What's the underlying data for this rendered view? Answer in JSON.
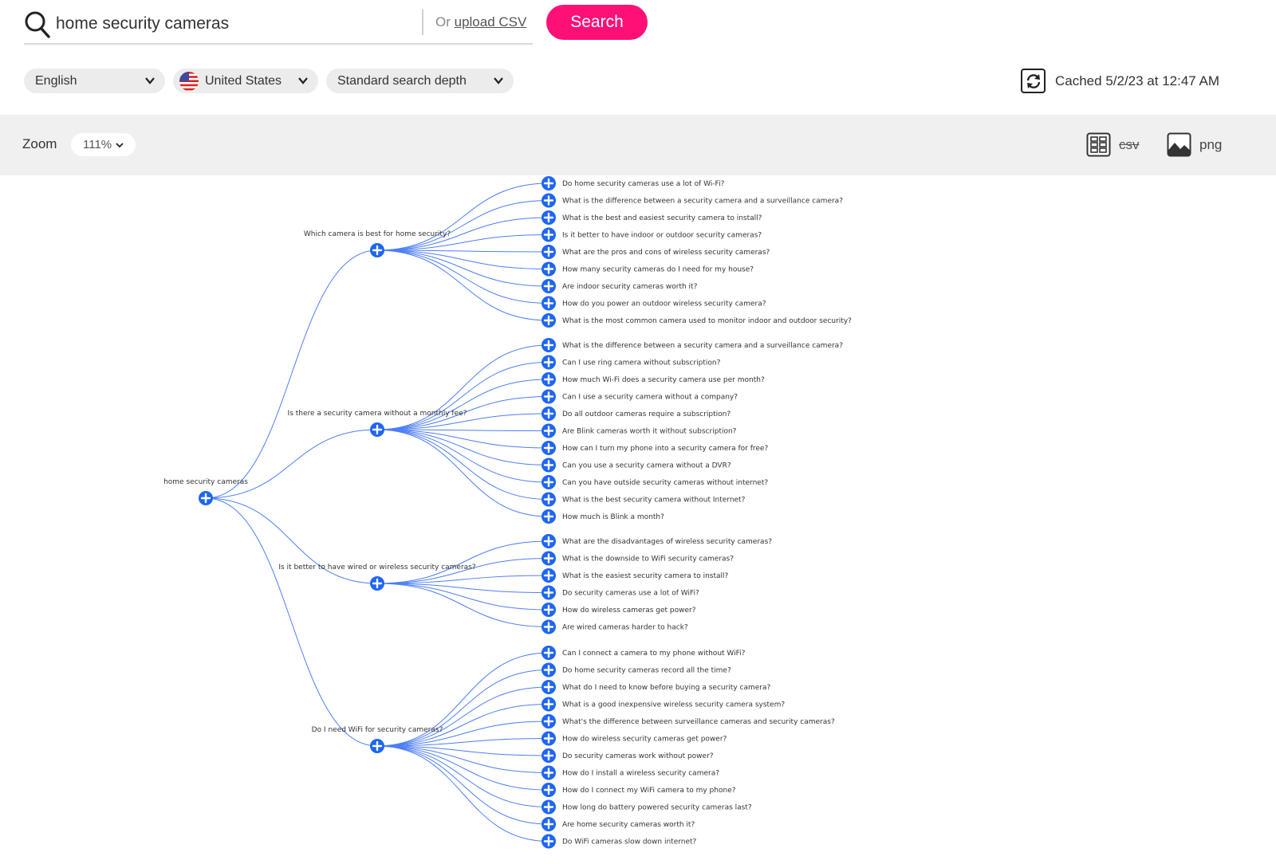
{
  "search": {
    "query": "home security cameras",
    "upload_prefix": "Or",
    "upload_link": "upload CSV",
    "button_label": "Search",
    "button_color": "#ff1077"
  },
  "filters": {
    "language": "English",
    "country": "United States",
    "depth": "Standard search depth"
  },
  "cached": {
    "text": "Cached 5/2/23 at 12:47 AM",
    "icon": "refresh-icon"
  },
  "toolbar": {
    "zoom_label": "Zoom",
    "zoom_value": "111%",
    "csv_label": "csv",
    "png_label": "png"
  },
  "colors": {
    "node": "#1f66f2",
    "link": "#4d7ef7",
    "toolbar_bg": "#f0f0f0"
  },
  "tree": {
    "root": "home security cameras",
    "branches": [
      {
        "label": "Which camera is best for home security?",
        "children": [
          "Do home security cameras use a lot of Wi-Fi?",
          "What is the difference between a security camera and a surveillance camera?",
          "What is the best and easiest security camera to install?",
          "Is it better to have indoor or outdoor security cameras?",
          "What are the pros and cons of wireless security cameras?",
          "How many security cameras do I need for my house?",
          "Are indoor security cameras worth it?",
          "How do you power an outdoor wireless security camera?",
          "What is the most common camera used to monitor indoor and outdoor security?"
        ]
      },
      {
        "label": "Is there a security camera without a monthly fee?",
        "children": [
          "What is the difference between a security camera and a surveillance camera?",
          "Can I use ring camera without subscription?",
          "How much Wi-Fi does a security camera use per month?",
          "Can I use a security camera without a company?",
          "Do all outdoor cameras require a subscription?",
          "Are Blink cameras worth it without subscription?",
          "How can I turn my phone into a security camera for free?",
          "Can you use a security camera without a DVR?",
          "Can you have outside security cameras without internet?",
          "What is the best security camera without Internet?",
          "How much is Blink a month?"
        ]
      },
      {
        "label": "Is it better to have wired or wireless security cameras?",
        "children": [
          "What are the disadvantages of wireless security cameras?",
          "What is the downside to WiFi security cameras?",
          "What is the easiest security camera to install?",
          "Do security cameras use a lot of WiFi?",
          "How do wireless cameras get power?",
          "Are wired cameras harder to hack?"
        ]
      },
      {
        "label": "Do I need WiFi for security cameras?",
        "children": [
          "Can I connect a camera to my phone without WiFi?",
          "Do home security cameras record all the time?",
          "What do I need to know before buying a security camera?",
          "What is a good inexpensive wireless security camera system?",
          "What's the difference between surveillance cameras and security cameras?",
          "How do wireless security cameras get power?",
          "Do security cameras work without power?",
          "How do I install a wireless security camera?",
          "How do I connect my WiFi camera to my phone?",
          "How long do battery powered security cameras last?",
          "Are home security cameras worth it?",
          "Do WiFi cameras slow down internet?"
        ]
      }
    ]
  }
}
